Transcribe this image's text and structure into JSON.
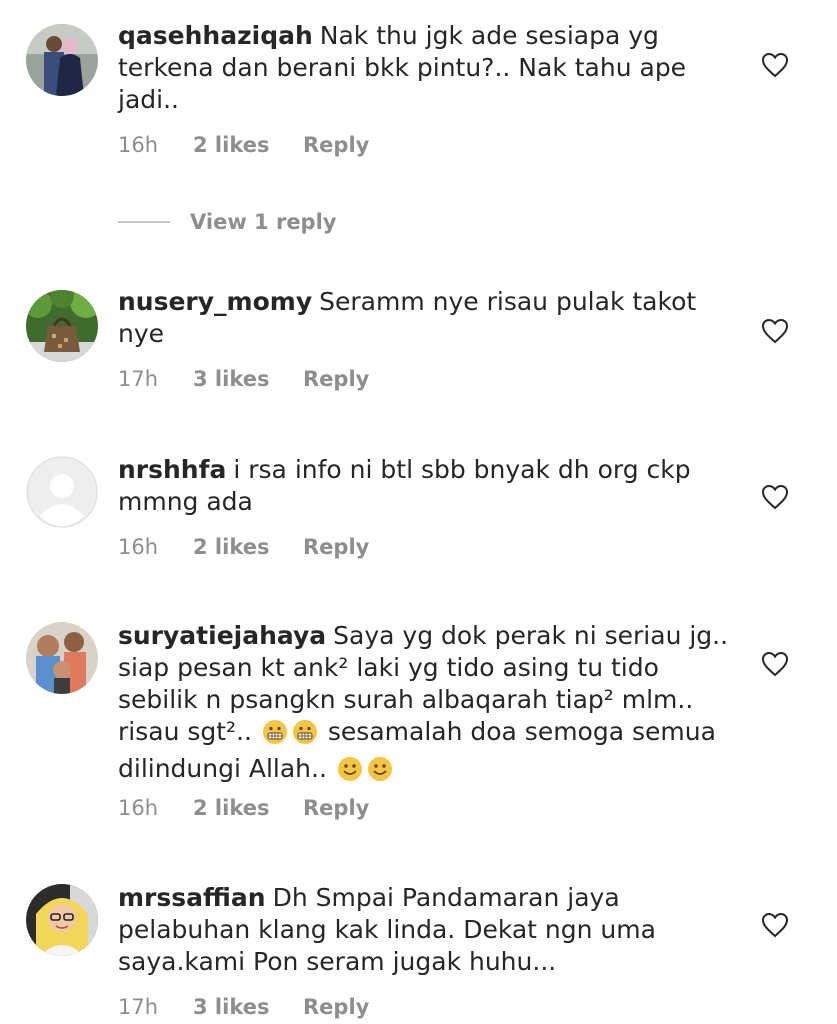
{
  "comments": [
    {
      "username": "qasehhaziqah",
      "text": "Nak thu jgk ade sesiapa yg terkena  dan berani bkk pintu?.. Nak tahu ape jadi..",
      "time": "16h",
      "likes": "2 likes",
      "reply_label": "Reply",
      "avatar": "photo-couple",
      "view_replies_label": "View 1 reply"
    },
    {
      "username": "nusery_momy",
      "text": "Seramm nye risau pulak takot nye",
      "time": "17h",
      "likes": "3 likes",
      "reply_label": "Reply",
      "avatar": "photo-handbag-plants"
    },
    {
      "username": "nrshhfa",
      "text": "i rsa info ni btl sbb bnyak dh org ckp mmng ada",
      "time": "16h",
      "likes": "2 likes",
      "reply_label": "Reply",
      "avatar": "default-profile"
    },
    {
      "username": "suryatiejahaya",
      "text_part1": "Saya yg dok perak ni seriau jg.. siap pesan kt ank² laki yg tido asing tu tido sebilik n psangkn surah albaqarah tiap² mlm.. risau sgt²..",
      "text_part2": "sesamalah doa semoga semua dilindungi Allah..",
      "emoji_grimace": "grimacing-face-emoji",
      "emoji_smile": "slightly-smiling-face-emoji",
      "time": "16h",
      "likes": "2 likes",
      "reply_label": "Reply",
      "avatar": "photo-children"
    },
    {
      "username": "mrssaffian",
      "text": "Dh Smpai Pandamaran jaya pelabuhan klang kak linda. Dekat ngn uma saya.kami Pon seram jugak huhu...",
      "time": "17h",
      "likes": "3 likes",
      "reply_label": "Reply",
      "avatar": "photo-woman-glasses"
    }
  ],
  "heart_icon": "heart-outline-icon",
  "colors": {
    "text": "#262626",
    "meta": "#8e8e8e",
    "divider": "#c7c7c7",
    "emoji": "#f5c542"
  }
}
